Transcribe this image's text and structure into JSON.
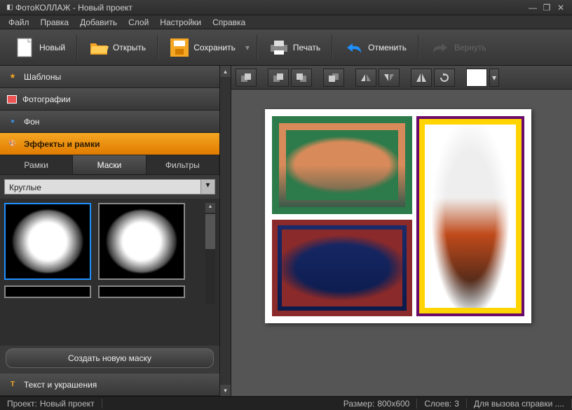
{
  "window": {
    "title": "ФотоКОЛЛАЖ - Новый проект"
  },
  "menu": [
    "Файл",
    "Правка",
    "Добавить",
    "Слой",
    "Настройки",
    "Справка"
  ],
  "toolbar": {
    "new": "Новый",
    "open": "Открыть",
    "save": "Сохранить",
    "print": "Печать",
    "undo": "Отменить",
    "redo": "Вернуть"
  },
  "accordion": {
    "templates": "Шаблоны",
    "photos": "Фотографии",
    "background": "Фон",
    "effects": "Эффекты и рамки",
    "text": "Текст и украшения"
  },
  "subtabs": {
    "frames": "Рамки",
    "masks": "Маски",
    "filters": "Фильтры"
  },
  "mask_category": "Круглые",
  "create_mask_btn": "Создать новую маску",
  "status": {
    "project_label": "Проект:",
    "project_value": "Новый проект",
    "size_label": "Размер:",
    "size_value": "800x600",
    "layers_label": "Слоев:",
    "layers_value": "3",
    "help": "Для вызова справки ...."
  },
  "canvas": {
    "layers": 3
  }
}
